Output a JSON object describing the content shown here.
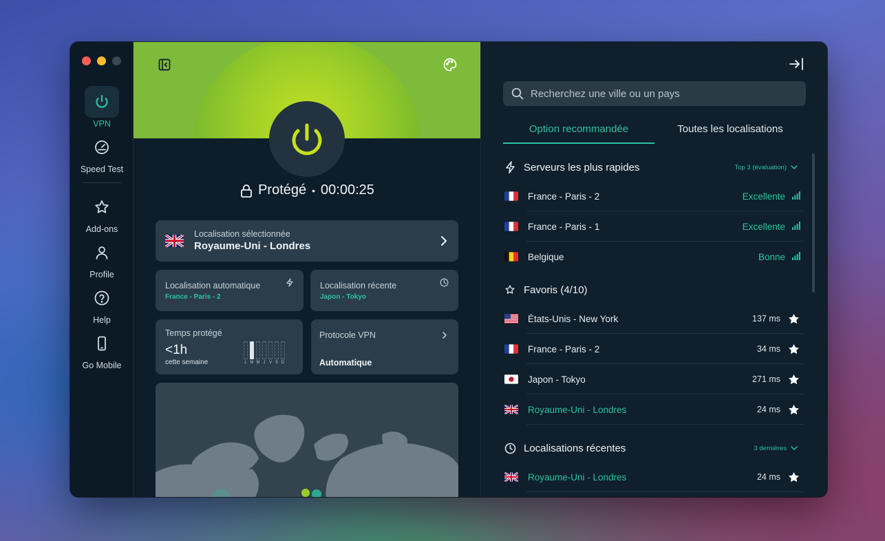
{
  "sidebar": {
    "items": [
      {
        "label": "VPN",
        "icon": "power-icon",
        "active": true
      },
      {
        "label": "Speed Test",
        "icon": "speedometer-icon"
      },
      {
        "label": "Add-ons",
        "icon": "star-icon"
      },
      {
        "label": "Profile",
        "icon": "user-icon"
      },
      {
        "label": "Help",
        "icon": "help-icon"
      },
      {
        "label": "Go Mobile",
        "icon": "mobile-icon"
      }
    ]
  },
  "main": {
    "status_label": "Protégé",
    "separator": "•",
    "timer": "00:00:25",
    "selected": {
      "caption": "Localisation sélectionnée",
      "value": "Royaume-Uni - Londres"
    },
    "auto": {
      "caption": "Localisation automatique",
      "value": "France - Paris - 2"
    },
    "recent": {
      "caption": "Localisation récente",
      "value": "Japon - Tokyo"
    },
    "protected_time": {
      "caption": "Temps protégé",
      "value": "<1h",
      "sub": "cette semaine",
      "days": [
        "L",
        "M",
        "M",
        "J",
        "V",
        "S",
        "D"
      ]
    },
    "protocol": {
      "caption": "Protocole VPN",
      "value": "Automatique"
    }
  },
  "panel": {
    "search_placeholder": "Recherchez une ville ou un pays",
    "tabs": [
      "Option recommandée",
      "Toutes les localisations"
    ],
    "fastest": {
      "title": "Serveurs les plus rapides",
      "more": "Top 3 (évaluation)",
      "rows": [
        {
          "name": "France - Paris - 2",
          "flag": "fr",
          "quality": "Excellente"
        },
        {
          "name": "France - Paris - 1",
          "flag": "fr",
          "quality": "Excellente"
        },
        {
          "name": "Belgique",
          "flag": "be",
          "quality": "Bonne"
        }
      ]
    },
    "favorites": {
      "title": "Favoris (4/10)",
      "rows": [
        {
          "name": "États-Unis - New York",
          "flag": "us",
          "ms": "137 ms"
        },
        {
          "name": "France - Paris - 2",
          "flag": "fr",
          "ms": "34 ms"
        },
        {
          "name": "Japon - Tokyo",
          "flag": "jp",
          "ms": "271 ms"
        },
        {
          "name": "Royaume-Uni - Londres",
          "flag": "uk",
          "ms": "24 ms"
        }
      ]
    },
    "recents": {
      "title": "Localisations récentes",
      "more": "3 dernières",
      "rows": [
        {
          "name": "Royaume-Uni - Londres",
          "flag": "uk",
          "ms": "24 ms"
        }
      ]
    }
  },
  "colors": {
    "accent": "#2bc3a3",
    "power": "#c9e01a"
  }
}
